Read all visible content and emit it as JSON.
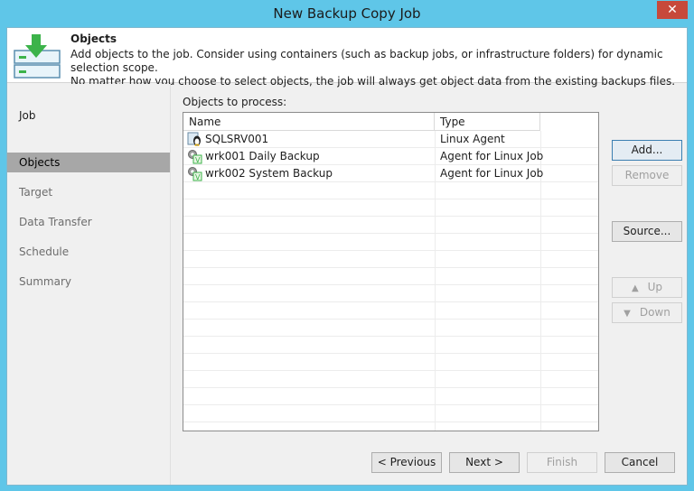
{
  "window": {
    "title": "New Backup Copy Job",
    "close_glyph": "✕"
  },
  "header": {
    "title": "Objects",
    "description_line1": "Add objects to the job. Consider using containers (such as backup jobs, or infrastructure folders) for dynamic selection scope.",
    "description_line2": "No matter how you choose to select objects, the job will always get object data from the existing backups files."
  },
  "nav": {
    "items": [
      {
        "label": "Job"
      },
      {
        "label": "Objects"
      },
      {
        "label": "Target"
      },
      {
        "label": "Data Transfer"
      },
      {
        "label": "Schedule"
      },
      {
        "label": "Summary"
      }
    ],
    "active_index": 1
  },
  "objects": {
    "label": "Objects to process:",
    "columns": [
      "Name",
      "Type"
    ],
    "rows": [
      {
        "name": "SQLSRV001",
        "type": "Linux Agent",
        "icon": "linux-agent-icon"
      },
      {
        "name": "wrk001 Daily Backup",
        "type": "Agent for Linux Job",
        "icon": "agent-job-icon"
      },
      {
        "name": "wrk002 System Backup",
        "type": "Agent for Linux Job",
        "icon": "agent-job-icon"
      }
    ]
  },
  "side_buttons": {
    "add": "Add...",
    "remove": "Remove",
    "source": "Source...",
    "up": "Up",
    "down": "Down"
  },
  "bottom_buttons": {
    "previous": "< Previous",
    "next": "Next >",
    "finish": "Finish",
    "cancel": "Cancel"
  },
  "colors": {
    "titlebar": "#5fc6e8",
    "close": "#c7493b",
    "nav_active": "#a7a7a7",
    "header_icon_green": "#3cb34a"
  }
}
